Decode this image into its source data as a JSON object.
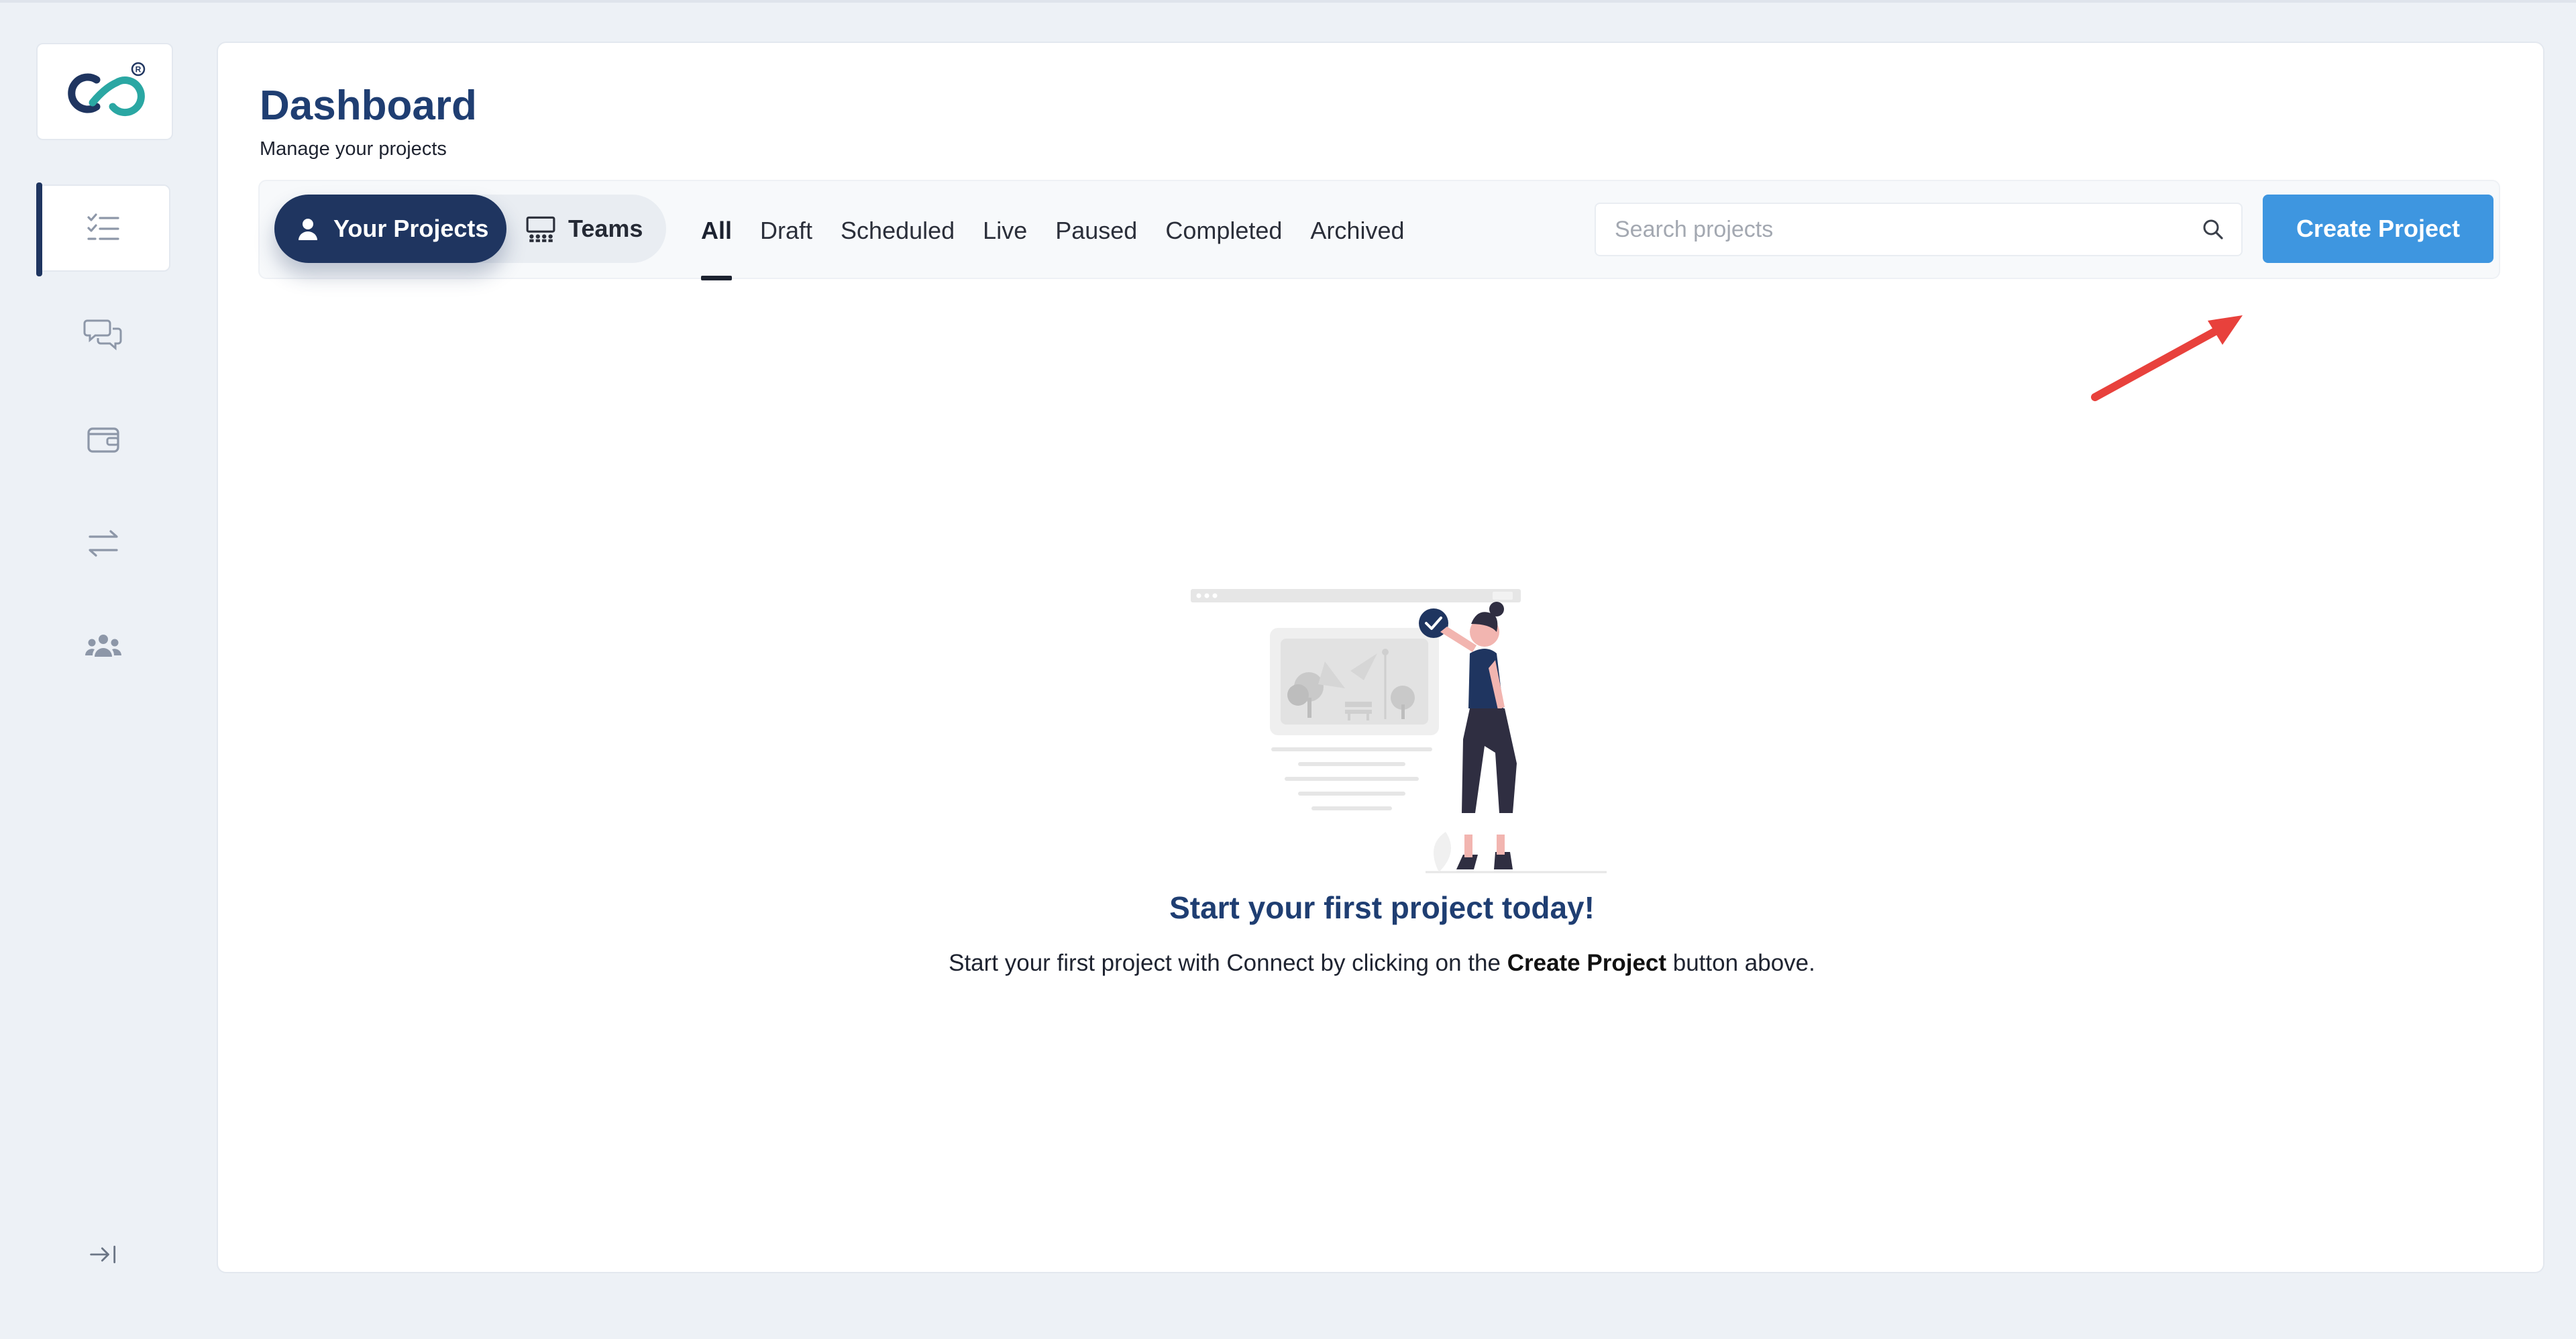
{
  "colors": {
    "primary": "#1f3560",
    "accent": "#3e96e0",
    "title": "#1f3e72",
    "annotation_arrow": "#e8413c"
  },
  "sidebar": {
    "logo": "connect-logo",
    "items": [
      {
        "icon": "list-check-icon",
        "active": true
      },
      {
        "icon": "chat-bubbles-icon",
        "active": false
      },
      {
        "icon": "wallet-icon",
        "active": false
      },
      {
        "icon": "transfer-arrows-icon",
        "active": false
      },
      {
        "icon": "team-users-icon",
        "active": false
      }
    ],
    "collapse_icon": "expand-sidebar-icon"
  },
  "header": {
    "title": "Dashboard",
    "subtitle": "Manage your projects"
  },
  "toolbar": {
    "segments": [
      {
        "label": "Your Projects",
        "icon": "user-icon",
        "active": true
      },
      {
        "label": "Teams",
        "icon": "team-board-icon",
        "active": false
      }
    ],
    "tabs": [
      {
        "label": "All",
        "active": true
      },
      {
        "label": "Draft",
        "active": false
      },
      {
        "label": "Scheduled",
        "active": false
      },
      {
        "label": "Live",
        "active": false
      },
      {
        "label": "Paused",
        "active": false
      },
      {
        "label": "Completed",
        "active": false
      },
      {
        "label": "Archived",
        "active": false
      }
    ],
    "search": {
      "placeholder": "Search projects",
      "value": ""
    },
    "create_label": "Create Project"
  },
  "empty_state": {
    "title": "Start your first project today!",
    "desc_before": "Start your first project with Connect by clicking on the ",
    "desc_bold": "Create Project",
    "desc_after": " button above."
  }
}
